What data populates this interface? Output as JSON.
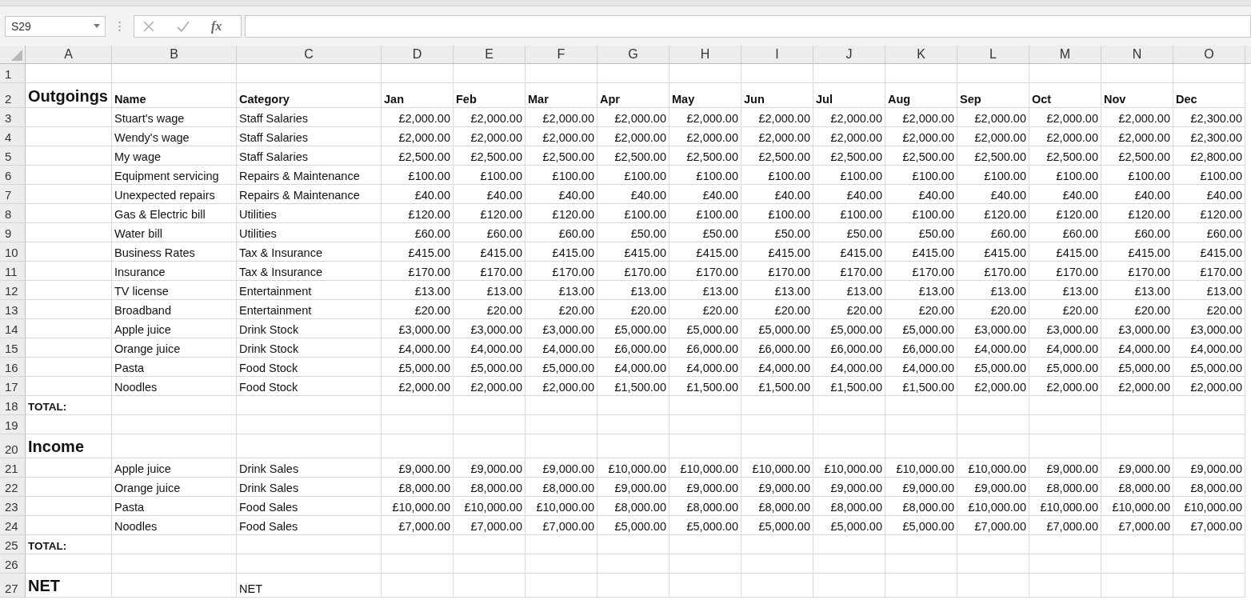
{
  "formula_bar": {
    "name_box": "S29",
    "function_symbol": "fx"
  },
  "columns": [
    "A",
    "B",
    "C",
    "D",
    "E",
    "F",
    "G",
    "H",
    "I",
    "J",
    "K",
    "L",
    "M",
    "N",
    "O"
  ],
  "rows": [
    {
      "number": "1",
      "kind": "blank"
    },
    {
      "number": "2",
      "kind": "header",
      "a": "Outgoings",
      "b": "Name",
      "c": "Category",
      "months": [
        "Jan",
        "Feb",
        "Mar",
        "Apr",
        "May",
        "Jun",
        "Jul",
        "Aug",
        "Sep",
        "Oct",
        "Nov",
        "Dec"
      ]
    },
    {
      "number": "3",
      "kind": "data",
      "b": "Stuart's wage",
      "c": "Staff Salaries",
      "months": [
        "£2,000.00",
        "£2,000.00",
        "£2,000.00",
        "£2,000.00",
        "£2,000.00",
        "£2,000.00",
        "£2,000.00",
        "£2,000.00",
        "£2,000.00",
        "£2,000.00",
        "£2,000.00",
        "£2,300.00"
      ]
    },
    {
      "number": "4",
      "kind": "data",
      "b": "Wendy's wage",
      "c": "Staff Salaries",
      "months": [
        "£2,000.00",
        "£2,000.00",
        "£2,000.00",
        "£2,000.00",
        "£2,000.00",
        "£2,000.00",
        "£2,000.00",
        "£2,000.00",
        "£2,000.00",
        "£2,000.00",
        "£2,000.00",
        "£2,300.00"
      ]
    },
    {
      "number": "5",
      "kind": "data",
      "b": "My wage",
      "c": "Staff Salaries",
      "months": [
        "£2,500.00",
        "£2,500.00",
        "£2,500.00",
        "£2,500.00",
        "£2,500.00",
        "£2,500.00",
        "£2,500.00",
        "£2,500.00",
        "£2,500.00",
        "£2,500.00",
        "£2,500.00",
        "£2,800.00"
      ]
    },
    {
      "number": "6",
      "kind": "data",
      "b": "Equipment servicing",
      "c": "Repairs & Maintenance",
      "months": [
        "£100.00",
        "£100.00",
        "£100.00",
        "£100.00",
        "£100.00",
        "£100.00",
        "£100.00",
        "£100.00",
        "£100.00",
        "£100.00",
        "£100.00",
        "£100.00"
      ]
    },
    {
      "number": "7",
      "kind": "data",
      "b": "Unexpected repairs",
      "c": "Repairs & Maintenance",
      "months": [
        "£40.00",
        "£40.00",
        "£40.00",
        "£40.00",
        "£40.00",
        "£40.00",
        "£40.00",
        "£40.00",
        "£40.00",
        "£40.00",
        "£40.00",
        "£40.00"
      ]
    },
    {
      "number": "8",
      "kind": "data",
      "b": "Gas & Electric bill",
      "c": "Utilities",
      "months": [
        "£120.00",
        "£120.00",
        "£120.00",
        "£100.00",
        "£100.00",
        "£100.00",
        "£100.00",
        "£100.00",
        "£120.00",
        "£120.00",
        "£120.00",
        "£120.00"
      ]
    },
    {
      "number": "9",
      "kind": "data",
      "b": "Water bill",
      "c": "Utilities",
      "months": [
        "£60.00",
        "£60.00",
        "£60.00",
        "£50.00",
        "£50.00",
        "£50.00",
        "£50.00",
        "£50.00",
        "£60.00",
        "£60.00",
        "£60.00",
        "£60.00"
      ]
    },
    {
      "number": "10",
      "kind": "data",
      "b": "Business Rates",
      "c": "Tax & Insurance",
      "months": [
        "£415.00",
        "£415.00",
        "£415.00",
        "£415.00",
        "£415.00",
        "£415.00",
        "£415.00",
        "£415.00",
        "£415.00",
        "£415.00",
        "£415.00",
        "£415.00"
      ]
    },
    {
      "number": "11",
      "kind": "data",
      "b": "Insurance",
      "c": "Tax & Insurance",
      "months": [
        "£170.00",
        "£170.00",
        "£170.00",
        "£170.00",
        "£170.00",
        "£170.00",
        "£170.00",
        "£170.00",
        "£170.00",
        "£170.00",
        "£170.00",
        "£170.00"
      ]
    },
    {
      "number": "12",
      "kind": "data",
      "b": "TV license",
      "c": "Entertainment",
      "months": [
        "£13.00",
        "£13.00",
        "£13.00",
        "£13.00",
        "£13.00",
        "£13.00",
        "£13.00",
        "£13.00",
        "£13.00",
        "£13.00",
        "£13.00",
        "£13.00"
      ]
    },
    {
      "number": "13",
      "kind": "data",
      "b": "Broadband",
      "c": "Entertainment",
      "months": [
        "£20.00",
        "£20.00",
        "£20.00",
        "£20.00",
        "£20.00",
        "£20.00",
        "£20.00",
        "£20.00",
        "£20.00",
        "£20.00",
        "£20.00",
        "£20.00"
      ]
    },
    {
      "number": "14",
      "kind": "data",
      "b": "Apple juice",
      "c": "Drink Stock",
      "months": [
        "£3,000.00",
        "£3,000.00",
        "£3,000.00",
        "£5,000.00",
        "£5,000.00",
        "£5,000.00",
        "£5,000.00",
        "£5,000.00",
        "£3,000.00",
        "£3,000.00",
        "£3,000.00",
        "£3,000.00"
      ]
    },
    {
      "number": "15",
      "kind": "data",
      "b": "Orange juice",
      "c": "Drink Stock",
      "months": [
        "£4,000.00",
        "£4,000.00",
        "£4,000.00",
        "£6,000.00",
        "£6,000.00",
        "£6,000.00",
        "£6,000.00",
        "£6,000.00",
        "£4,000.00",
        "£4,000.00",
        "£4,000.00",
        "£4,000.00"
      ]
    },
    {
      "number": "16",
      "kind": "data",
      "b": "Pasta",
      "c": "Food Stock",
      "months": [
        "£5,000.00",
        "£5,000.00",
        "£5,000.00",
        "£4,000.00",
        "£4,000.00",
        "£4,000.00",
        "£4,000.00",
        "£4,000.00",
        "£5,000.00",
        "£5,000.00",
        "£5,000.00",
        "£5,000.00"
      ]
    },
    {
      "number": "17",
      "kind": "data",
      "b": "Noodles",
      "c": "Food Stock",
      "months": [
        "£2,000.00",
        "£2,000.00",
        "£2,000.00",
        "£1,500.00",
        "£1,500.00",
        "£1,500.00",
        "£1,500.00",
        "£1,500.00",
        "£2,000.00",
        "£2,000.00",
        "£2,000.00",
        "£2,000.00"
      ]
    },
    {
      "number": "18",
      "kind": "total",
      "a": "TOTAL:"
    },
    {
      "number": "19",
      "kind": "blank"
    },
    {
      "number": "20",
      "kind": "section",
      "a": "Income"
    },
    {
      "number": "21",
      "kind": "data",
      "b": "Apple juice",
      "c": "Drink Sales",
      "months": [
        "£9,000.00",
        "£9,000.00",
        "£9,000.00",
        "£10,000.00",
        "£10,000.00",
        "£10,000.00",
        "£10,000.00",
        "£10,000.00",
        "£10,000.00",
        "£9,000.00",
        "£9,000.00",
        "£9,000.00"
      ]
    },
    {
      "number": "22",
      "kind": "data",
      "b": "Orange juice",
      "c": "Drink Sales",
      "months": [
        "£8,000.00",
        "£8,000.00",
        "£8,000.00",
        "£9,000.00",
        "£9,000.00",
        "£9,000.00",
        "£9,000.00",
        "£9,000.00",
        "£9,000.00",
        "£8,000.00",
        "£8,000.00",
        "£8,000.00"
      ]
    },
    {
      "number": "23",
      "kind": "data",
      "b": "Pasta",
      "c": "Food Sales",
      "months": [
        "£10,000.00",
        "£10,000.00",
        "£10,000.00",
        "£8,000.00",
        "£8,000.00",
        "£8,000.00",
        "£8,000.00",
        "£8,000.00",
        "£10,000.00",
        "£10,000.00",
        "£10,000.00",
        "£10,000.00"
      ]
    },
    {
      "number": "24",
      "kind": "data",
      "b": "Noodles",
      "c": "Food Sales",
      "months": [
        "£7,000.00",
        "£7,000.00",
        "£7,000.00",
        "£5,000.00",
        "£5,000.00",
        "£5,000.00",
        "£5,000.00",
        "£5,000.00",
        "£7,000.00",
        "£7,000.00",
        "£7,000.00",
        "£7,000.00"
      ]
    },
    {
      "number": "25",
      "kind": "total",
      "a": "TOTAL:"
    },
    {
      "number": "26",
      "kind": "blank"
    },
    {
      "number": "27",
      "kind": "section",
      "a": "NET",
      "c": "NET"
    }
  ]
}
